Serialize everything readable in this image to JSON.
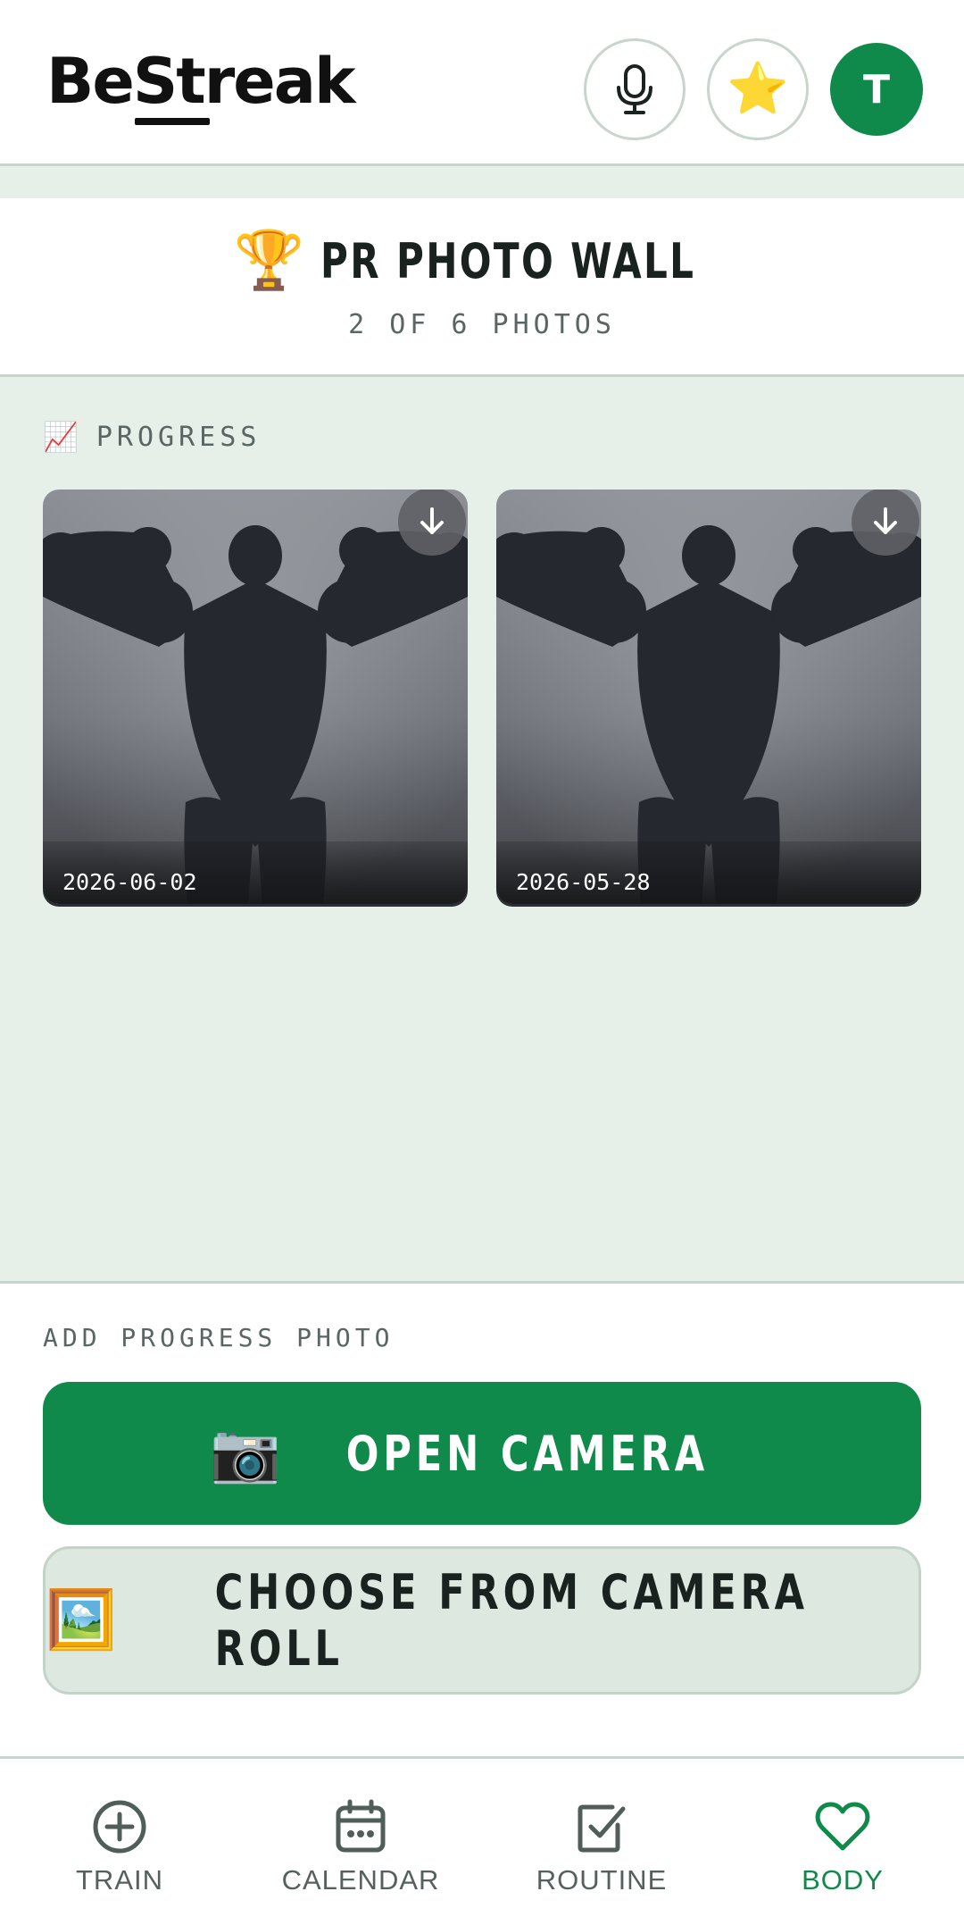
{
  "header": {
    "logo_part1": "Be",
    "logo_part2": "St",
    "logo_part3": "reak",
    "star_glyph": "⭐",
    "avatar_initial": "T"
  },
  "title_section": {
    "trophy_glyph": "🏆",
    "title": "PR PHOTO WALL",
    "subtitle": "2 OF 6 PHOTOS"
  },
  "gallery": {
    "section_icon": "📈",
    "section_label": "PROGRESS",
    "photos": [
      {
        "date": "2026-06-02"
      },
      {
        "date": "2026-05-28"
      }
    ]
  },
  "add_photo": {
    "label": "ADD PROGRESS PHOTO",
    "open_camera_icon": "📷",
    "open_camera_label": "OPEN CAMERA",
    "camera_roll_icon": "🖼️",
    "camera_roll_label": "CHOOSE FROM CAMERA ROLL"
  },
  "nav": {
    "items": [
      {
        "label": "TRAIN",
        "icon": "plus-circle-icon"
      },
      {
        "label": "CALENDAR",
        "icon": "calendar-icon"
      },
      {
        "label": "ROUTINE",
        "icon": "checkbox-icon"
      },
      {
        "label": "BODY",
        "icon": "heart-icon",
        "active": true
      }
    ]
  },
  "colors": {
    "accent": "#0f8a4a",
    "background": "#e6f0e8",
    "muted_text": "#5a6663"
  }
}
